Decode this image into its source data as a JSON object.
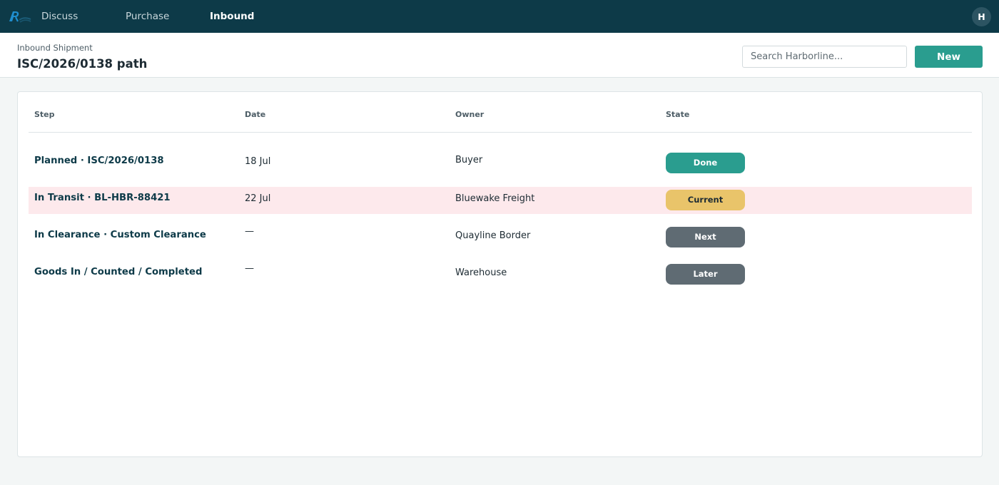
{
  "colors": {
    "topbar": "#0d3a48",
    "accent": "#2a9d8f",
    "current_row": "#fde9ec",
    "badge_done": "#2a9d8f",
    "badge_current": "#e9c46a",
    "badge_next": "#5f6b73",
    "badge_later": "#5f6b73"
  },
  "topbar": {
    "logo_icon": "harborline-logo-icon",
    "nav": [
      {
        "label": "Discuss",
        "active": false
      },
      {
        "label": "Purchase",
        "active": false
      },
      {
        "label": "Inbound",
        "active": true
      }
    ],
    "avatar_initial": "H"
  },
  "header": {
    "breadcrumb": "Inbound Shipment",
    "title": "ISC/2026/0138 path",
    "search_placeholder": "Search Harborline...",
    "new_label": "New"
  },
  "table": {
    "columns": {
      "step": "Step",
      "date": "Date",
      "owner": "Owner",
      "state": "State"
    },
    "rows": [
      {
        "step": "Planned  ·  ISC/2026/0138",
        "date": "18 Jul",
        "owner": "Buyer",
        "state": "Done",
        "current": false
      },
      {
        "step": "In Transit  ·  BL-HBR-88421",
        "date": "22 Jul",
        "owner": "Bluewake Freight",
        "state": "Current",
        "current": true
      },
      {
        "step": "In Clearance  ·  Custom Clearance",
        "date": "—",
        "owner": "Quayline Border",
        "state": "Next",
        "current": false
      },
      {
        "step": "Goods In / Counted / Completed",
        "date": "—",
        "owner": "Warehouse",
        "state": "Later",
        "current": false
      }
    ]
  }
}
